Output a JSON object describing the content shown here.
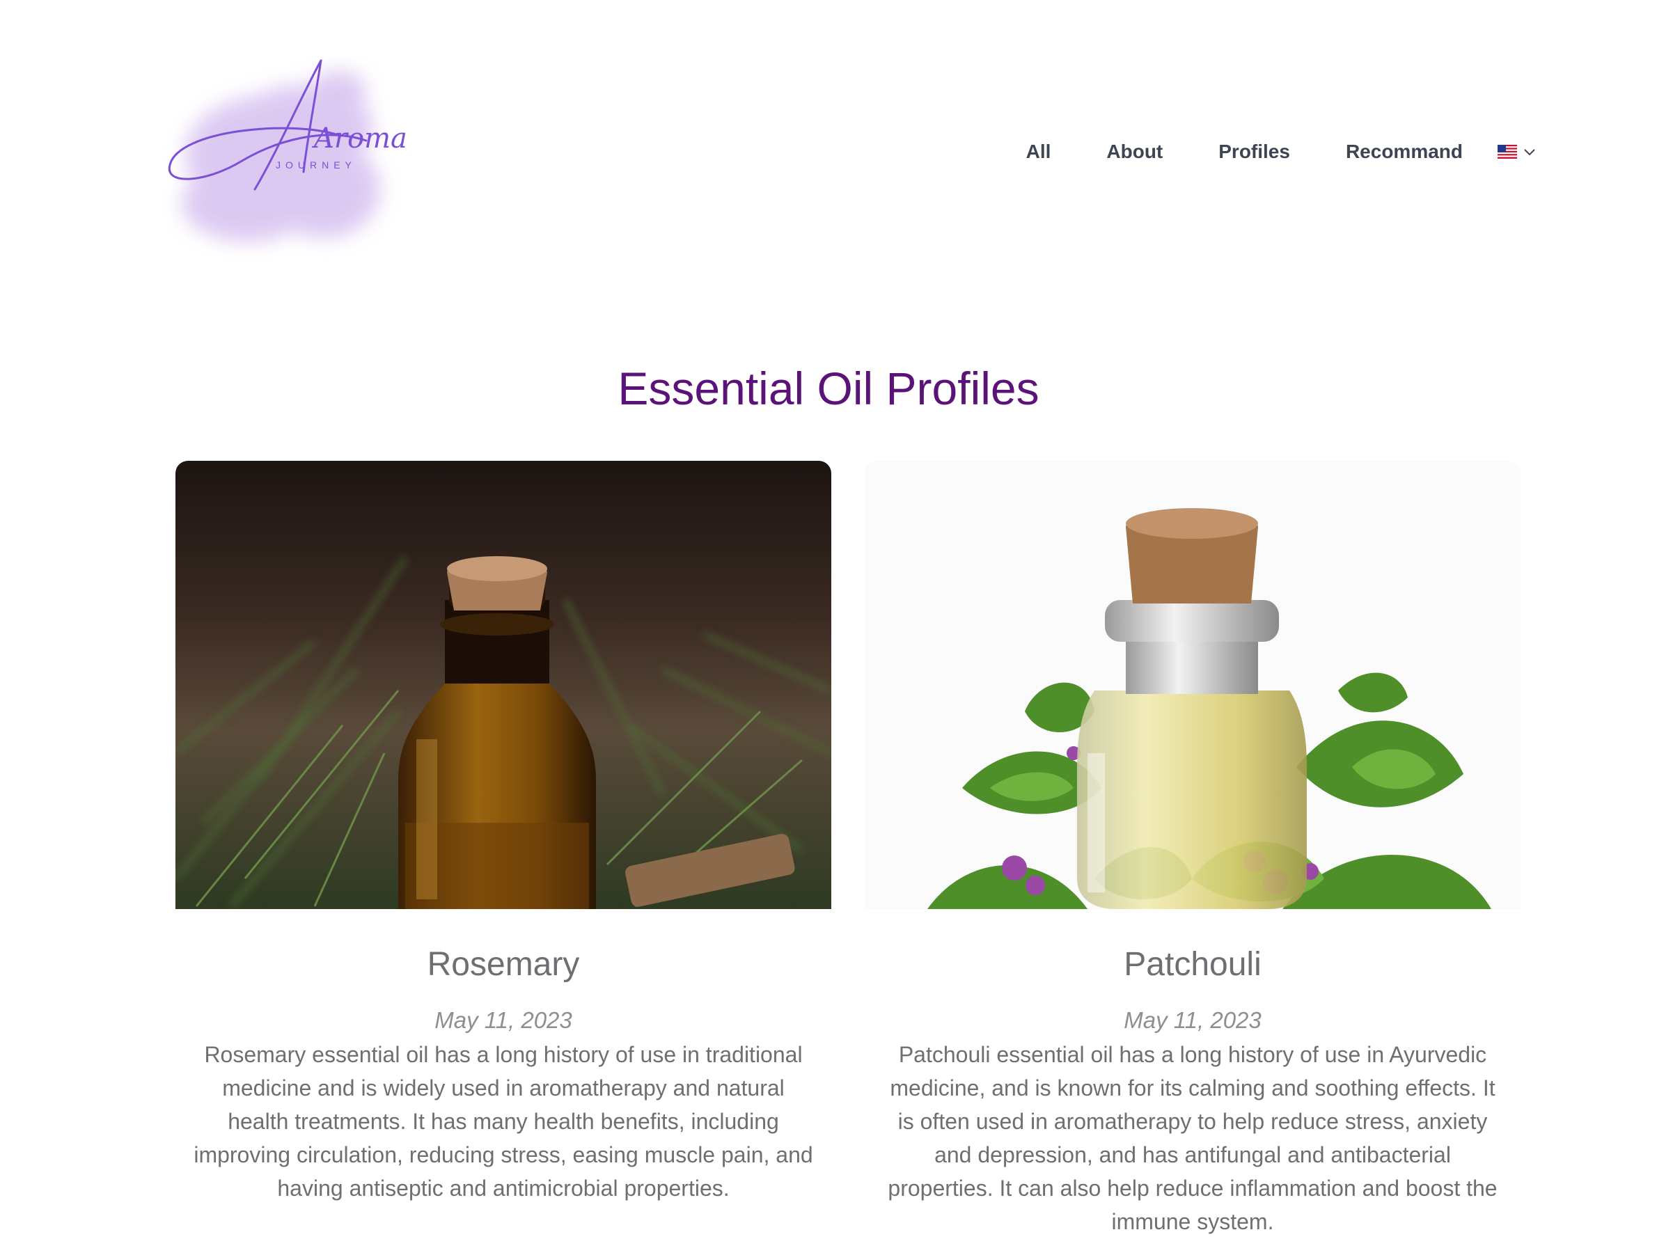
{
  "brand": {
    "logo_word": "Aroma",
    "logo_sub": "JOURNEY",
    "logo_color": "#7b4fd6",
    "logo_wash_color": "#d9c4f1"
  },
  "nav": {
    "items": [
      "All",
      "About",
      "Profiles",
      "Recommand"
    ],
    "language_icon": "us-flag-icon",
    "dropdown_icon": "chevron-down-icon"
  },
  "page": {
    "title": "Essential Oil Profiles",
    "title_color": "#5b1379"
  },
  "profiles": [
    {
      "name": "Rosemary",
      "date": "May 11, 2023",
      "description": "Rosemary essential oil has a long history of use in traditional medicine and is widely used in aromatherapy and natural health treatments. It has many health benefits, including improving circulation, reducing stress, easing muscle pain, and having antiseptic and antimicrobial properties.",
      "image": "rosemary-oil-bottle-photo"
    },
    {
      "name": "Patchouli",
      "date": "May 11, 2023",
      "description": "Patchouli essential oil has a long history of use in Ayurvedic medicine, and is known for its calming and soothing effects. It is often used in aromatherapy to help reduce stress, anxiety and depression, and has antifungal and antibacterial properties. It can also help reduce inflammation and boost the immune system.",
      "image": "patchouli-oil-bottle-photo"
    }
  ]
}
